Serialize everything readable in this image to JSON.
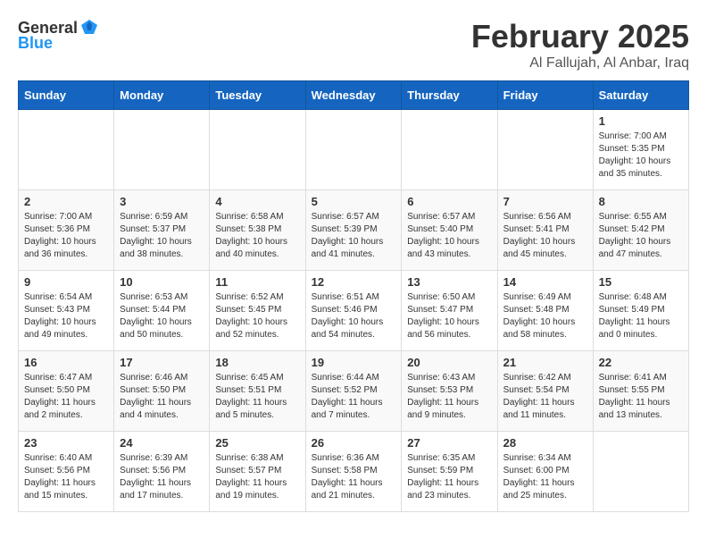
{
  "header": {
    "logo_general": "General",
    "logo_blue": "Blue",
    "title": "February 2025",
    "subtitle": "Al Fallujah, Al Anbar, Iraq"
  },
  "calendar": {
    "days_of_week": [
      "Sunday",
      "Monday",
      "Tuesday",
      "Wednesday",
      "Thursday",
      "Friday",
      "Saturday"
    ],
    "weeks": [
      [
        {
          "day": "",
          "info": ""
        },
        {
          "day": "",
          "info": ""
        },
        {
          "day": "",
          "info": ""
        },
        {
          "day": "",
          "info": ""
        },
        {
          "day": "",
          "info": ""
        },
        {
          "day": "",
          "info": ""
        },
        {
          "day": "1",
          "info": "Sunrise: 7:00 AM\nSunset: 5:35 PM\nDaylight: 10 hours and 35 minutes."
        }
      ],
      [
        {
          "day": "2",
          "info": "Sunrise: 7:00 AM\nSunset: 5:36 PM\nDaylight: 10 hours and 36 minutes."
        },
        {
          "day": "3",
          "info": "Sunrise: 6:59 AM\nSunset: 5:37 PM\nDaylight: 10 hours and 38 minutes."
        },
        {
          "day": "4",
          "info": "Sunrise: 6:58 AM\nSunset: 5:38 PM\nDaylight: 10 hours and 40 minutes."
        },
        {
          "day": "5",
          "info": "Sunrise: 6:57 AM\nSunset: 5:39 PM\nDaylight: 10 hours and 41 minutes."
        },
        {
          "day": "6",
          "info": "Sunrise: 6:57 AM\nSunset: 5:40 PM\nDaylight: 10 hours and 43 minutes."
        },
        {
          "day": "7",
          "info": "Sunrise: 6:56 AM\nSunset: 5:41 PM\nDaylight: 10 hours and 45 minutes."
        },
        {
          "day": "8",
          "info": "Sunrise: 6:55 AM\nSunset: 5:42 PM\nDaylight: 10 hours and 47 minutes."
        }
      ],
      [
        {
          "day": "9",
          "info": "Sunrise: 6:54 AM\nSunset: 5:43 PM\nDaylight: 10 hours and 49 minutes."
        },
        {
          "day": "10",
          "info": "Sunrise: 6:53 AM\nSunset: 5:44 PM\nDaylight: 10 hours and 50 minutes."
        },
        {
          "day": "11",
          "info": "Sunrise: 6:52 AM\nSunset: 5:45 PM\nDaylight: 10 hours and 52 minutes."
        },
        {
          "day": "12",
          "info": "Sunrise: 6:51 AM\nSunset: 5:46 PM\nDaylight: 10 hours and 54 minutes."
        },
        {
          "day": "13",
          "info": "Sunrise: 6:50 AM\nSunset: 5:47 PM\nDaylight: 10 hours and 56 minutes."
        },
        {
          "day": "14",
          "info": "Sunrise: 6:49 AM\nSunset: 5:48 PM\nDaylight: 10 hours and 58 minutes."
        },
        {
          "day": "15",
          "info": "Sunrise: 6:48 AM\nSunset: 5:49 PM\nDaylight: 11 hours and 0 minutes."
        }
      ],
      [
        {
          "day": "16",
          "info": "Sunrise: 6:47 AM\nSunset: 5:50 PM\nDaylight: 11 hours and 2 minutes."
        },
        {
          "day": "17",
          "info": "Sunrise: 6:46 AM\nSunset: 5:50 PM\nDaylight: 11 hours and 4 minutes."
        },
        {
          "day": "18",
          "info": "Sunrise: 6:45 AM\nSunset: 5:51 PM\nDaylight: 11 hours and 5 minutes."
        },
        {
          "day": "19",
          "info": "Sunrise: 6:44 AM\nSunset: 5:52 PM\nDaylight: 11 hours and 7 minutes."
        },
        {
          "day": "20",
          "info": "Sunrise: 6:43 AM\nSunset: 5:53 PM\nDaylight: 11 hours and 9 minutes."
        },
        {
          "day": "21",
          "info": "Sunrise: 6:42 AM\nSunset: 5:54 PM\nDaylight: 11 hours and 11 minutes."
        },
        {
          "day": "22",
          "info": "Sunrise: 6:41 AM\nSunset: 5:55 PM\nDaylight: 11 hours and 13 minutes."
        }
      ],
      [
        {
          "day": "23",
          "info": "Sunrise: 6:40 AM\nSunset: 5:56 PM\nDaylight: 11 hours and 15 minutes."
        },
        {
          "day": "24",
          "info": "Sunrise: 6:39 AM\nSunset: 5:56 PM\nDaylight: 11 hours and 17 minutes."
        },
        {
          "day": "25",
          "info": "Sunrise: 6:38 AM\nSunset: 5:57 PM\nDaylight: 11 hours and 19 minutes."
        },
        {
          "day": "26",
          "info": "Sunrise: 6:36 AM\nSunset: 5:58 PM\nDaylight: 11 hours and 21 minutes."
        },
        {
          "day": "27",
          "info": "Sunrise: 6:35 AM\nSunset: 5:59 PM\nDaylight: 11 hours and 23 minutes."
        },
        {
          "day": "28",
          "info": "Sunrise: 6:34 AM\nSunset: 6:00 PM\nDaylight: 11 hours and 25 minutes."
        },
        {
          "day": "",
          "info": ""
        }
      ]
    ]
  }
}
